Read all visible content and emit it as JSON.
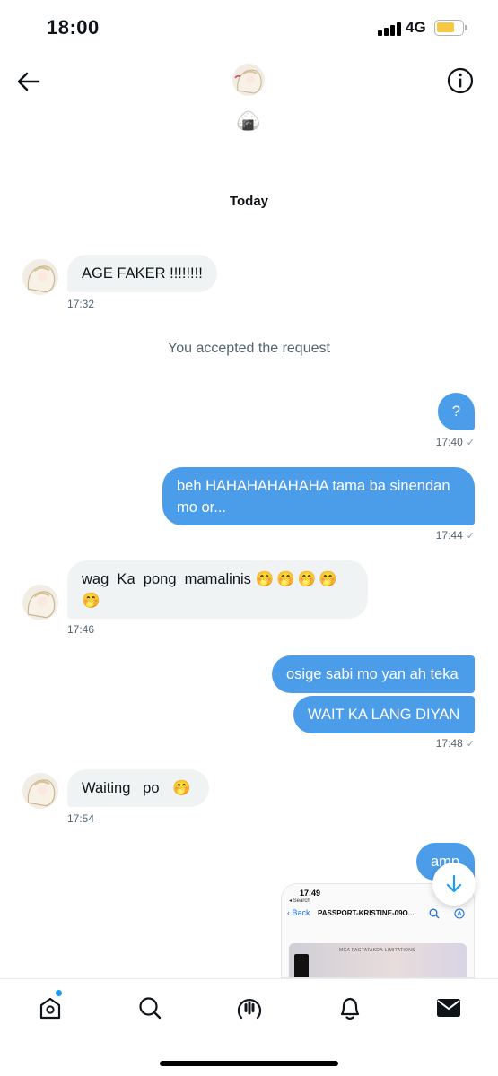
{
  "status_bar": {
    "time": "18:00",
    "network": "4G"
  },
  "header": {
    "name_emoji": "🍙"
  },
  "conversation": {
    "day_label": "Today",
    "system_message": "You accepted the request",
    "messages": [
      {
        "text": "AGE FAKER !!!!!!!!",
        "time": "17:32",
        "direction": "incoming"
      },
      {
        "text": "?",
        "time": "17:40",
        "direction": "outgoing"
      },
      {
        "line1": "beh HAHAHAHAHAHA tama ba sinendan",
        "line2": "mo or...",
        "time": "17:44",
        "direction": "outgoing"
      },
      {
        "line1": "wag  Ka  pong  mamalinis",
        "emoji1": "🤭🤭🤭🤭",
        "emoji2": "🤭",
        "time": "17:46",
        "direction": "incoming"
      },
      {
        "text": "osige sabi mo yan ah teka",
        "direction": "outgoing"
      },
      {
        "text": "WAIT KA LANG DIYAN",
        "time": "17:48",
        "direction": "outgoing"
      },
      {
        "text": "Waiting   po",
        "emoji": "🤭",
        "time": "17:54",
        "direction": "incoming"
      },
      {
        "text": "amp",
        "direction": "outgoing"
      }
    ],
    "attachment": {
      "status_time": "17:49",
      "nav_search": "◂ Search",
      "back": "Back",
      "title": "PASSPORT-KRISTINE-09O...",
      "doc_label": "MGA PAGTATAKDA-LIMITATIONS"
    }
  },
  "colors": {
    "outgoing_bubble": "#4b9dea",
    "incoming_bubble": "#eff3f4",
    "accent": "#1d9bf0"
  },
  "icons": {
    "back": "arrow-left-icon",
    "info": "info-icon",
    "scroll": "arrow-down-icon",
    "tabs": [
      "home-icon",
      "search-icon",
      "spaces-icon",
      "bell-icon",
      "mail-icon"
    ]
  },
  "tab_bar": {
    "home_has_notification": true,
    "active_tab": "messages"
  }
}
